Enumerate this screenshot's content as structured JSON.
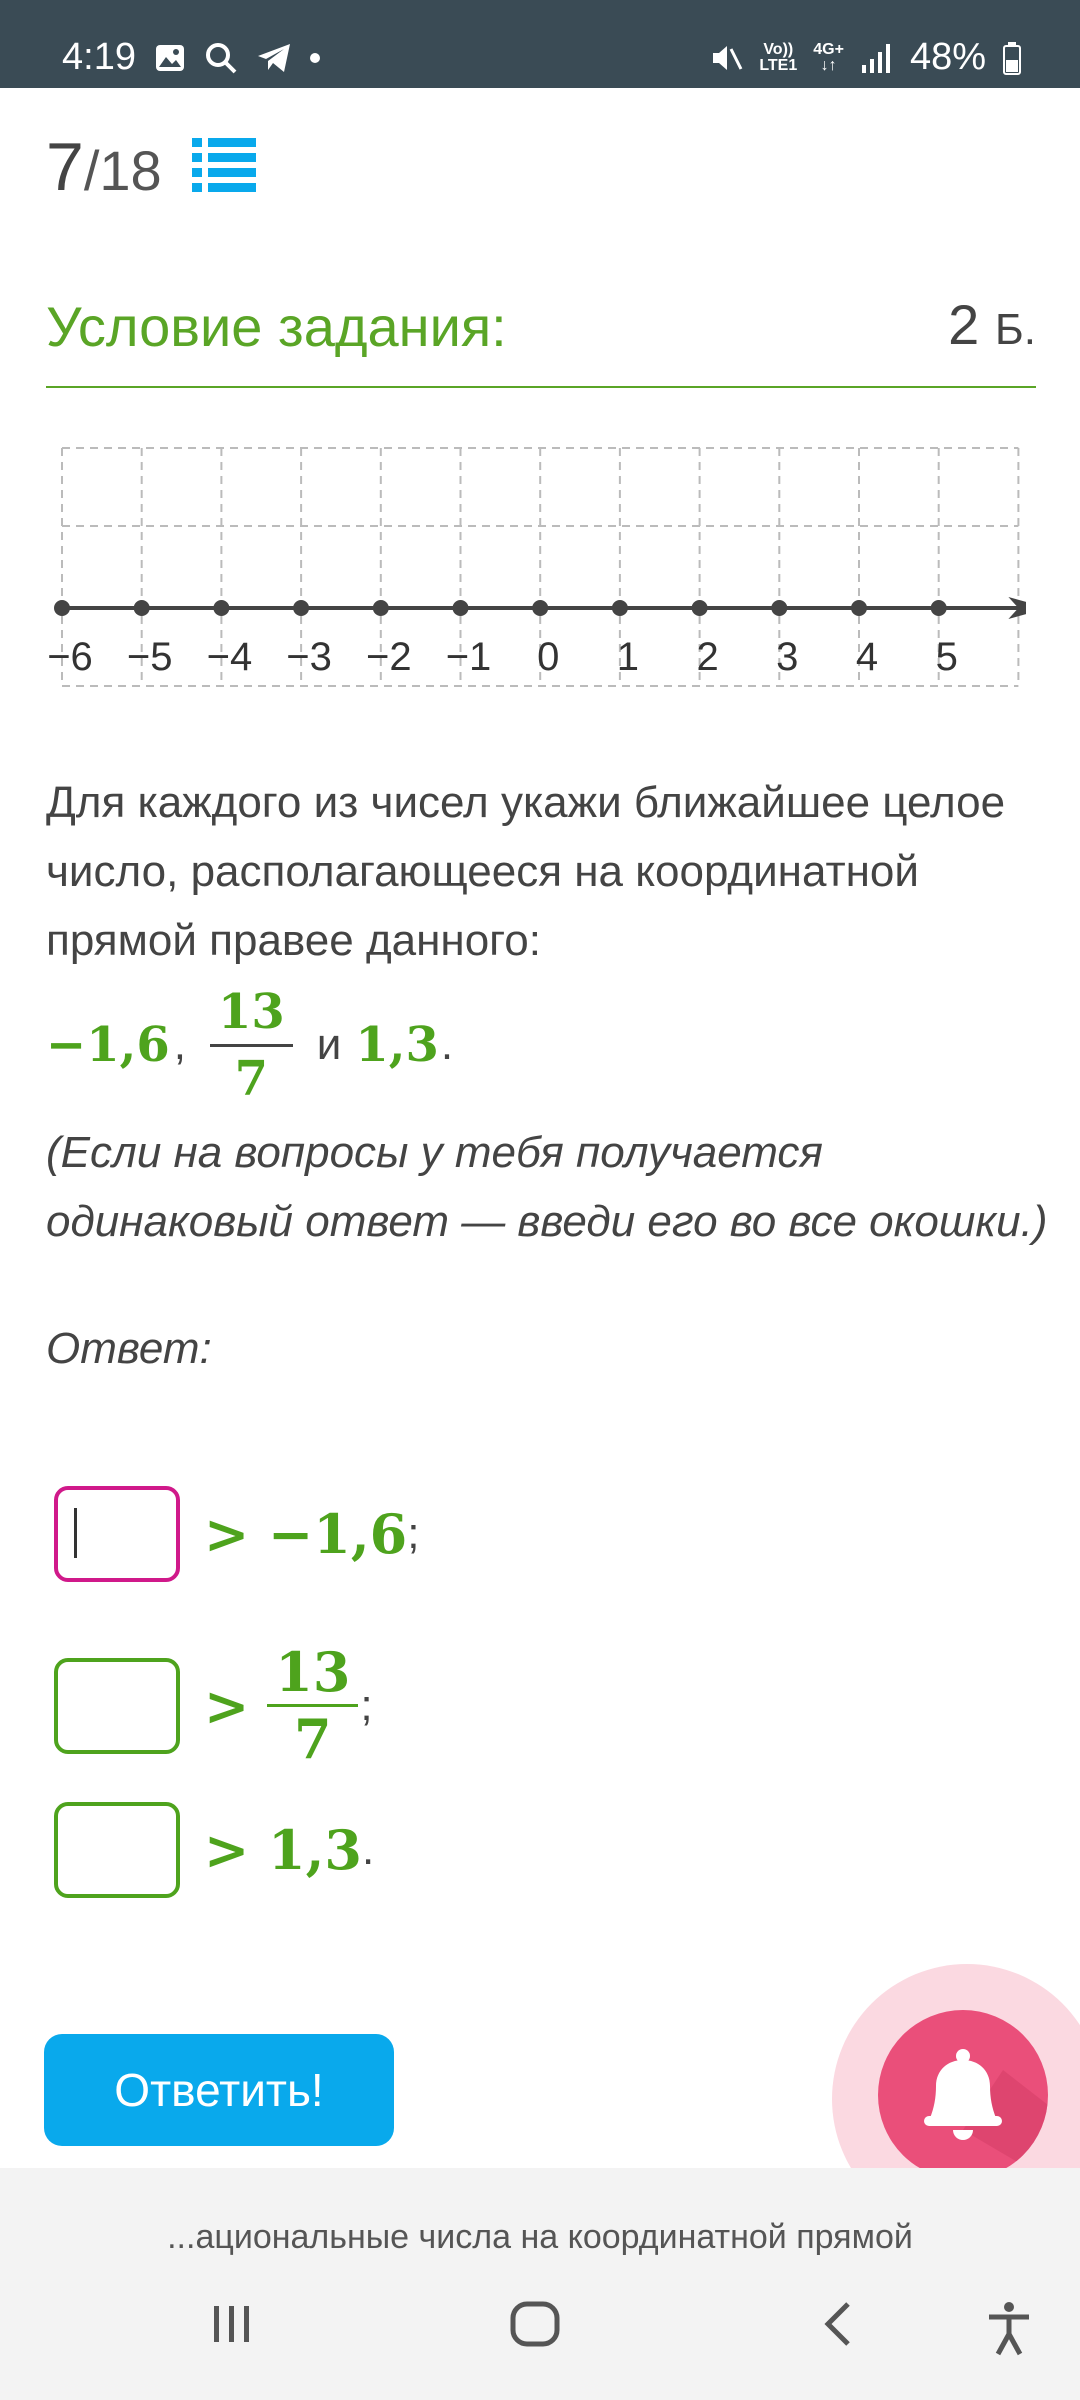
{
  "status_bar": {
    "time": "4:19",
    "volte": "Vo))\nLTE1",
    "network": "4G+",
    "battery": "48%",
    "icons": [
      "image-icon",
      "search-icon",
      "telegram-icon",
      "dot-icon",
      "mute-icon",
      "signal-icon",
      "battery-icon"
    ]
  },
  "header": {
    "current": "7",
    "total": "/18",
    "list_icon": "list-icon"
  },
  "section": {
    "title": "Условие задания:",
    "points_value": "2",
    "points_unit": "Б."
  },
  "number_line": {
    "labels": [
      "−6",
      "−5",
      "−4",
      "−3",
      "−2",
      "−1",
      "0",
      "1",
      "2",
      "3",
      "4",
      "5"
    ]
  },
  "task": {
    "text": "Для каждого из чисел укажи ближайшее целое число, располагающееся на координатной прямой правее данного:",
    "number1": "−1,6",
    "comma": ",",
    "frac_num": "13",
    "frac_den": "7",
    "and": "и",
    "number3": "1,3",
    "period": ".",
    "note": "(Если на вопросы у тебя получается одинаковый ответ — введи его во все окошки.)"
  },
  "answer": {
    "label": "Ответ:",
    "rows": [
      {
        "relation": "> −1,6",
        "punct": ";",
        "value": ""
      },
      {
        "relation_sign": ">",
        "frac_num": "13",
        "frac_den": "7",
        "punct": ";",
        "value": ""
      },
      {
        "relation": "> 1,3",
        "punct": ".",
        "value": ""
      }
    ]
  },
  "submit": {
    "label": "Ответить!"
  },
  "footer": {
    "topic": "...ациональные числа на координатной прямой"
  },
  "colors": {
    "green": "#4ea31d",
    "pink": "#d0198a",
    "button_blue": "#09a9ec",
    "bell": "#ea4f7a",
    "status_bg": "#3a4b55"
  }
}
